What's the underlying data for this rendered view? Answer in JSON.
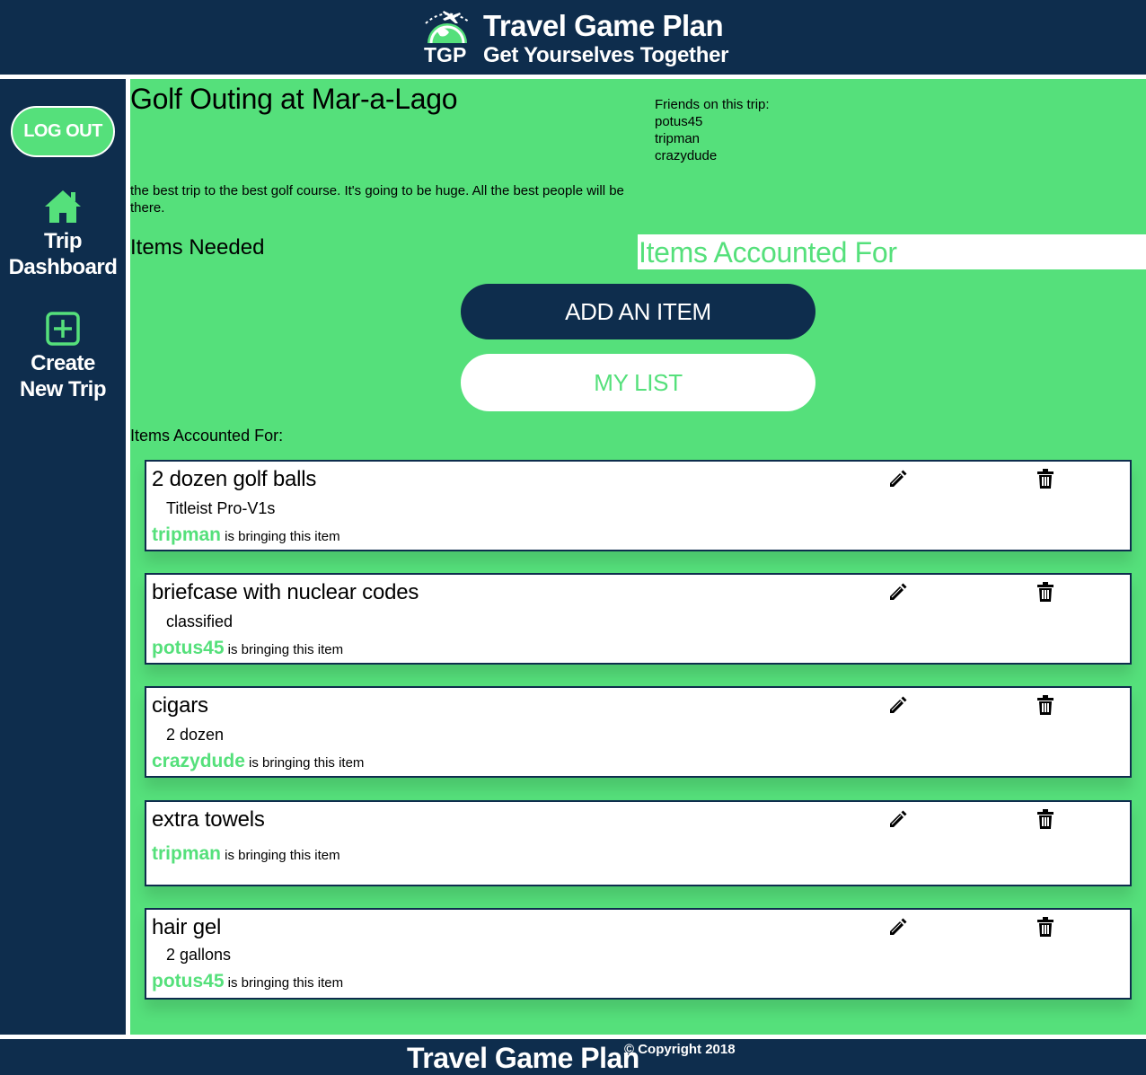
{
  "header": {
    "logo_text": "TGP",
    "title": "Travel Game Plan",
    "tagline": "Get Yourselves Together"
  },
  "sidebar": {
    "logout_label": "LOG OUT",
    "nav": [
      {
        "label_line1": "Trip",
        "label_line2": "Dashboard",
        "icon": "home-icon"
      },
      {
        "label_line1": "Create",
        "label_line2": "New Trip",
        "icon": "plus-square-icon"
      }
    ]
  },
  "trip": {
    "title": "Golf Outing at Mar-a-Lago",
    "description": "the best trip to the best golf course. It's going to be huge. All the best people will be there.",
    "friends_label": "Friends on this trip:",
    "friends": [
      "potus45",
      "tripman",
      "crazydude"
    ]
  },
  "sections": {
    "items_needed": "Items Needed",
    "items_accounted_banner": "Items Accounted For",
    "items_accounted_label": "Items Accounted For:"
  },
  "actions": {
    "add_item": "ADD AN ITEM",
    "my_list": "MY LIST"
  },
  "items": [
    {
      "name": "2 dozen golf balls",
      "detail": "Titleist Pro-V1s",
      "bringer": "tripman",
      "bringing_text": " is bringing this item"
    },
    {
      "name": "briefcase with nuclear codes",
      "detail": "classified",
      "bringer": "potus45",
      "bringing_text": " is bringing this item"
    },
    {
      "name": "cigars",
      "detail": "2 dozen",
      "bringer": "crazydude",
      "bringing_text": " is bringing this item"
    },
    {
      "name": "extra towels",
      "detail": "",
      "bringer": "tripman",
      "bringing_text": " is bringing this item"
    },
    {
      "name": "hair gel",
      "detail": "2 gallons",
      "bringer": "potus45",
      "bringing_text": " is bringing this item"
    }
  ],
  "footer": {
    "title": "Travel Game Plan",
    "copyright": "© Copyright 2018"
  },
  "colors": {
    "navy": "#0e2d4d",
    "green": "#55e07b",
    "white": "#ffffff"
  }
}
